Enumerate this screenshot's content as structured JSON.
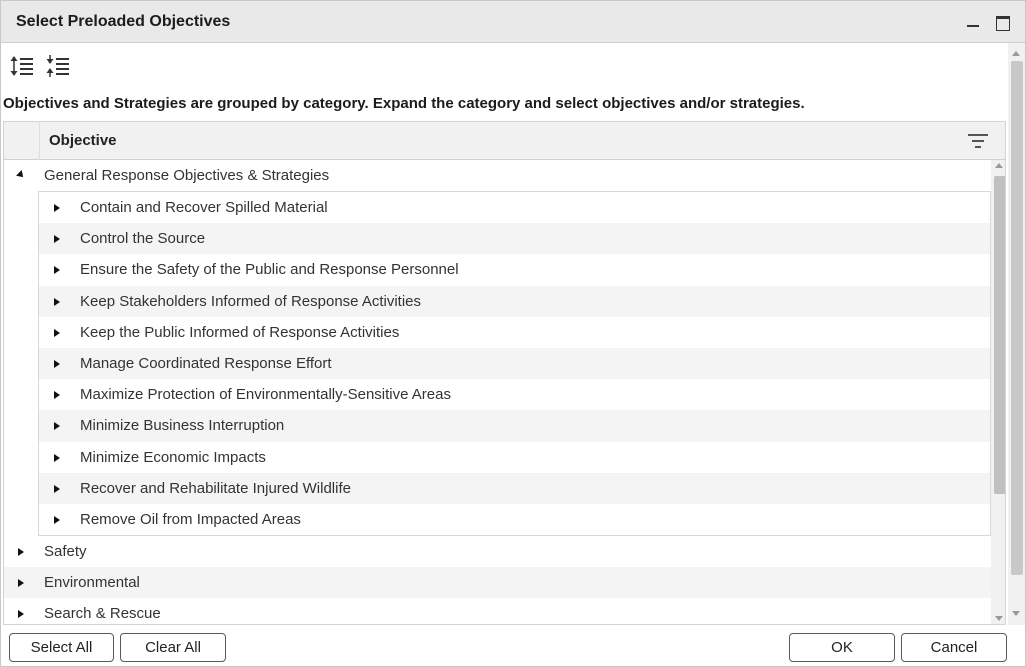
{
  "dialog": {
    "title": "Select Preloaded Objectives"
  },
  "toolbar": {
    "expand_all_icon": "expand-all-icon",
    "collapse_all_icon": "collapse-all-icon"
  },
  "instructions": "Objectives and Strategies are grouped by category.  Expand the category and select objectives and/or strategies.",
  "grid": {
    "column_header": "Objective",
    "filter_icon": "filter-icon",
    "categories": [
      {
        "label": "General Response Objectives & Strategies",
        "expanded": true,
        "objectives": [
          "Contain and Recover Spilled Material",
          "Control the Source",
          "Ensure the Safety of the Public and Response Personnel",
          "Keep Stakeholders Informed of Response Activities",
          "Keep the Public Informed of Response Activities",
          "Manage Coordinated Response Effort",
          "Maximize Protection of Environmentally-Sensitive Areas",
          "Minimize Business Interruption",
          "Minimize Economic Impacts",
          "Recover and Rehabilitate Injured Wildlife",
          "Remove Oil from Impacted Areas"
        ]
      },
      {
        "label": "Safety",
        "expanded": false
      },
      {
        "label": "Environmental",
        "expanded": false
      },
      {
        "label": "Search & Rescue",
        "expanded": false
      }
    ]
  },
  "footer": {
    "select_all": "Select All",
    "clear_all": "Clear All",
    "ok": "OK",
    "cancel": "Cancel"
  }
}
